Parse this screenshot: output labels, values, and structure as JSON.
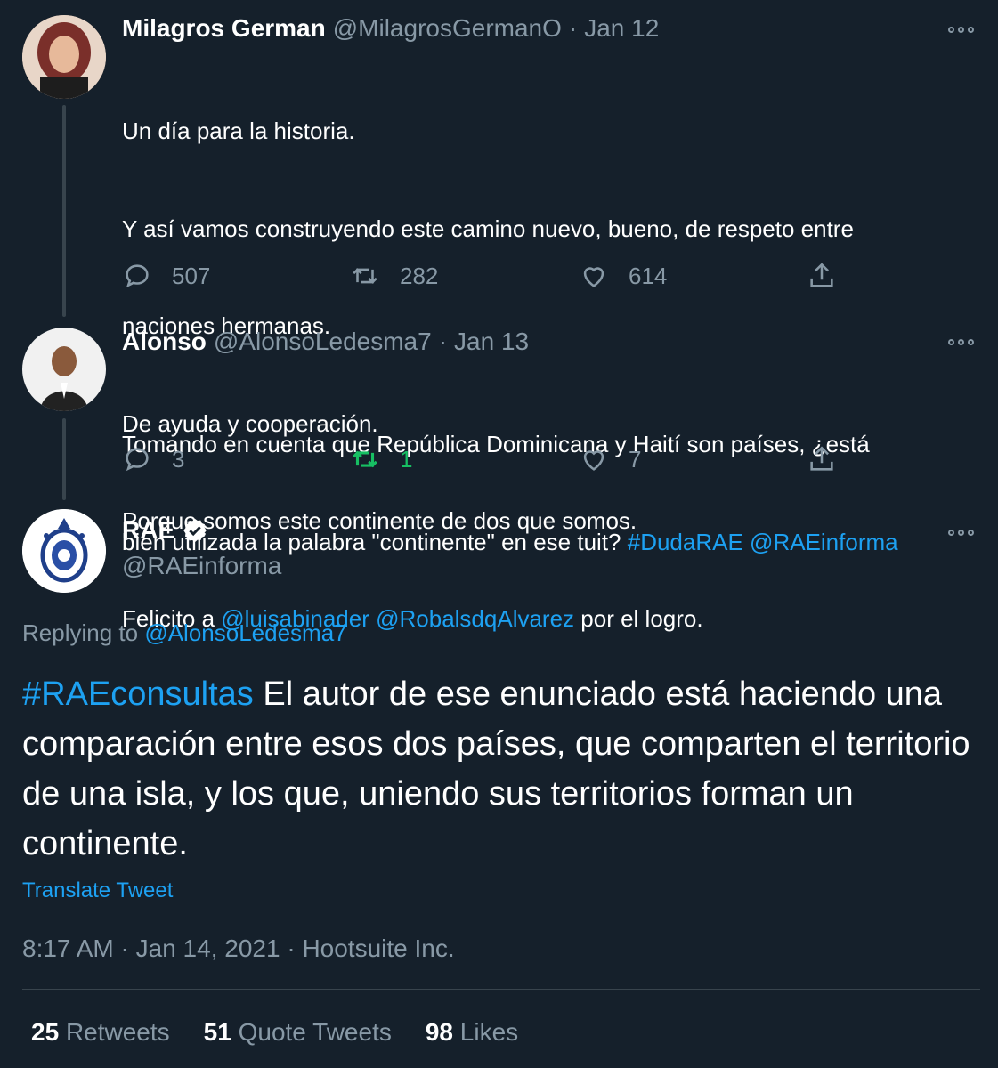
{
  "tweet1": {
    "name": "Milagros German",
    "handle": "@MilagrosGermanO",
    "separator": "·",
    "date": "Jan 12",
    "lines": [
      "Un día para la historia.",
      "Y así vamos construyendo este camino nuevo, bueno, de respeto entre",
      "naciones hermanas.",
      "De ayuda y cooperación.",
      "Porque somos este continente de dos que somos."
    ],
    "last_line_prefix": "Felicito a ",
    "mention1": "@luisabinader",
    "mention2": "@RobalsdqAlvarez",
    "last_line_suffix": " por el logro.",
    "replies": "507",
    "retweets": "282",
    "likes": "614"
  },
  "tweet2": {
    "name": "Alonso",
    "handle": "@AlonsoLedesma7",
    "separator": "·",
    "date": "Jan 13",
    "line1": "Tomando en cuenta que República Dominicana y Haití son países, ¿está",
    "line2_prefix": "bien utilizada la palabra \"continente\" en ese tuit? ",
    "hashtag": "#DudaRAE",
    "mention": "@RAEinforma",
    "replies": "3",
    "retweets": "1",
    "likes": "7",
    "retweet_color": "#17bf63"
  },
  "tweet3": {
    "name": "RAE",
    "handle": "@RAEinforma",
    "replying_label": "Replying to ",
    "replying_to": "@AlonsoLedesma7",
    "hashtag": "#RAEconsultas",
    "text": " El autor de ese enunciado está haciendo una comparación entre esos dos países, que comparten el territorio de una isla, y los que, uniendo sus territorios forman un continente.",
    "translate": "Translate Tweet",
    "time": "8:17 AM",
    "sep": "·",
    "full_date": "Jan 14, 2021",
    "source": "Hootsuite Inc.",
    "stats": {
      "retweets_count": "25",
      "retweets_label": "Retweets",
      "quotes_count": "51",
      "quotes_label": "Quote Tweets",
      "likes_count": "98",
      "likes_label": "Likes"
    }
  },
  "colors": {
    "background": "#15202b",
    "link": "#1da1f2",
    "secondary": "#8899a6",
    "retweeted": "#17bf63"
  }
}
